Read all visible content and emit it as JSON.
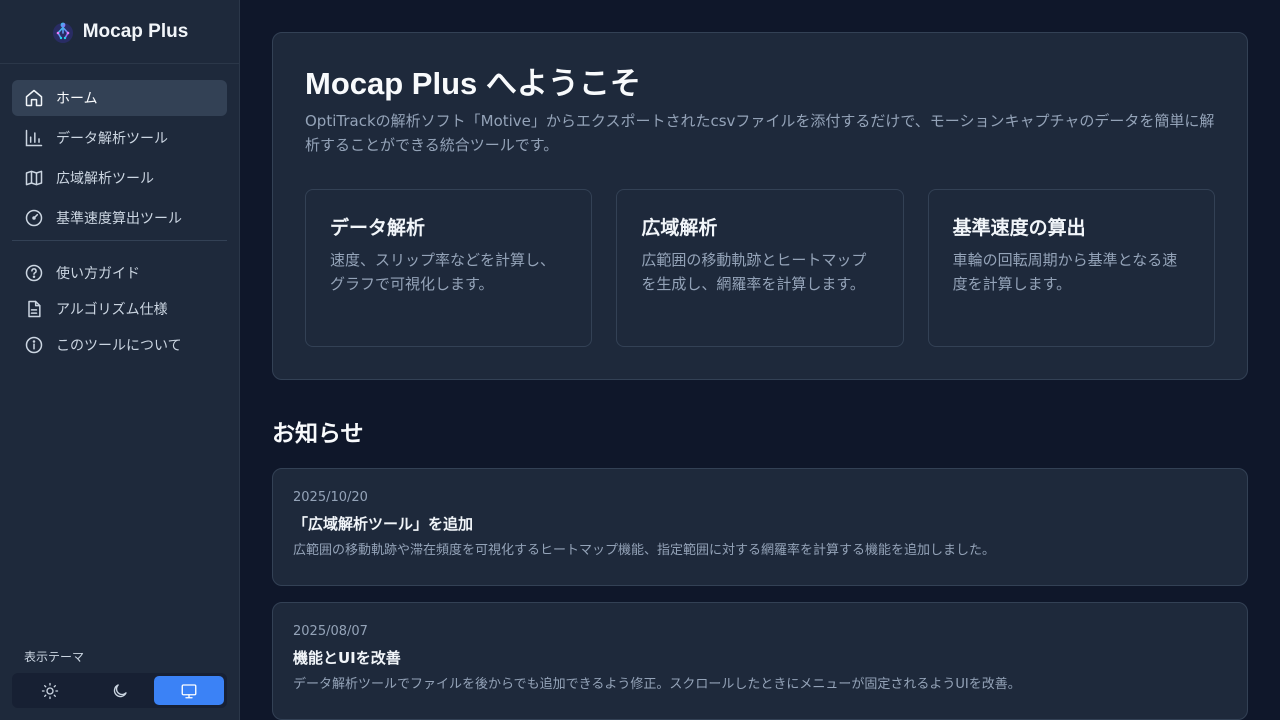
{
  "app": {
    "name": "Mocap Plus"
  },
  "sidebar": {
    "items": [
      {
        "label": "ホーム",
        "icon": "home-icon",
        "active": true
      },
      {
        "label": "データ解析ツール",
        "icon": "bar-chart-icon"
      },
      {
        "label": "広域解析ツール",
        "icon": "map-icon"
      },
      {
        "label": "基準速度算出ツール",
        "icon": "gauge-icon"
      }
    ],
    "secondary": [
      {
        "label": "使い方ガイド",
        "icon": "help-circle-icon"
      },
      {
        "label": "アルゴリズム仕様",
        "icon": "document-icon"
      },
      {
        "label": "このツールについて",
        "icon": "info-icon"
      }
    ],
    "theme_label": "表示テーマ",
    "theme_options": [
      {
        "name": "light",
        "icon": "sun-icon"
      },
      {
        "name": "dark",
        "icon": "moon-icon"
      },
      {
        "name": "system",
        "icon": "monitor-icon",
        "selected": true
      }
    ]
  },
  "hero": {
    "title": "Mocap Plus へようこそ",
    "intro": "OptiTrackの解析ソフト「Motive」からエクスポートされたcsvファイルを添付するだけで、モーションキャプチャのデータを簡単に解析することができる統合ツールです。",
    "features": [
      {
        "title": "データ解析",
        "text": "速度、スリップ率などを計算し、グラフで可視化します。"
      },
      {
        "title": "広域解析",
        "text": "広範囲の移動軌跡とヒートマップを生成し、網羅率を計算します。"
      },
      {
        "title": "基準速度の算出",
        "text": "車輪の回転周期から基準となる速度を計算します。"
      }
    ]
  },
  "news": {
    "title": "お知らせ",
    "items": [
      {
        "date": "2025/10/20",
        "title": "「広域解析ツール」を追加",
        "text": "広範囲の移動軌跡や滞在頻度を可視化するヒートマップ機能、指定範囲に対する網羅率を計算する機能を追加しました。"
      },
      {
        "date": "2025/08/07",
        "title": "機能とUIを改善",
        "text": "データ解析ツールでファイルを後からでも追加できるよう修正。スクロールしたときにメニューが固定されるようUIを改善。"
      }
    ]
  },
  "colors": {
    "background": "#0f172a",
    "sidebar": "#1e293b",
    "card": "#1e293b",
    "accent": "#3b82f6"
  }
}
